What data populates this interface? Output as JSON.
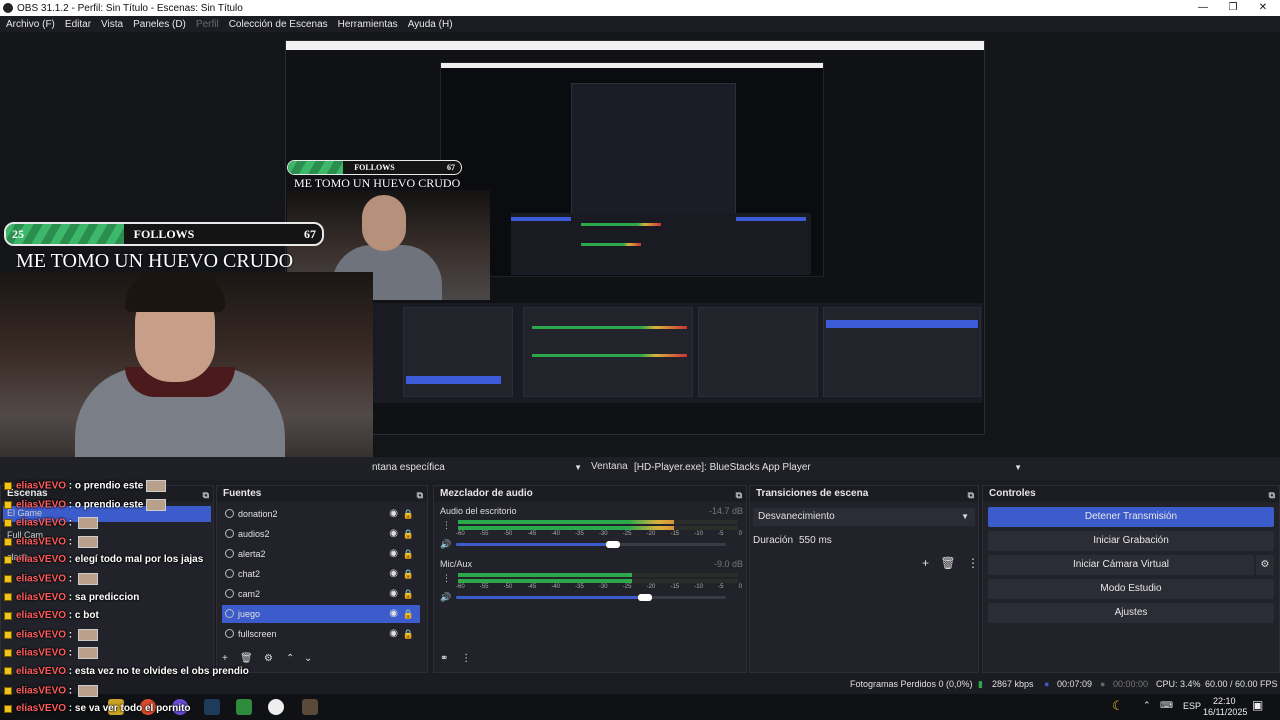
{
  "window": {
    "title": "OBS 31.1.2 - Perfil: Sin Título - Escenas: Sin Título",
    "minimize": "—",
    "maximize": "❐",
    "close": "✕"
  },
  "menu": [
    {
      "label": "Archivo (F)",
      "disabled": false
    },
    {
      "label": "Editar",
      "disabled": false
    },
    {
      "label": "Vista",
      "disabled": false
    },
    {
      "label": "Paneles (D)",
      "disabled": false
    },
    {
      "label": "Perfil",
      "disabled": true
    },
    {
      "label": "Colección de Escenas",
      "disabled": false
    },
    {
      "label": "Herramientas",
      "disabled": false
    },
    {
      "label": "Ayuda (H)",
      "disabled": false
    }
  ],
  "overlay": {
    "follow_left": "25",
    "follow_label": "FOLLOWS",
    "follow_right": "67",
    "headline": "ME TOMO UN HUEVO CRUDO"
  },
  "source_bar": {
    "method_value": "ntana específica",
    "window_label": "Ventana",
    "window_value": "[HD-Player.exe]: BlueStacks App Player"
  },
  "docks": {
    "scenes_title": "Escenas",
    "sources_title": "Fuentes",
    "mixer_title": "Mezclador de audio",
    "transitions_title": "Transiciones de escena",
    "controls_title": "Controles"
  },
  "scenes": [
    "El Game",
    "Full Cam",
    "clash"
  ],
  "sources": [
    {
      "name": "donation2",
      "selected": false
    },
    {
      "name": "audios2",
      "selected": false
    },
    {
      "name": "alerta2",
      "selected": false
    },
    {
      "name": "chat2",
      "selected": false
    },
    {
      "name": "cam2",
      "selected": false
    },
    {
      "name": "juego",
      "selected": true
    },
    {
      "name": "fullscreen",
      "selected": false
    }
  ],
  "mixer": [
    {
      "name": "Audio del escritorio",
      "db": "-14.7 dB",
      "level": 0.77,
      "volume": 0.58
    },
    {
      "name": "Mic/Aux",
      "db": "-9.0 dB",
      "level": 0.62,
      "volume": 0.7
    }
  ],
  "meter_ticks": [
    "-60",
    "-55",
    "-50",
    "-45",
    "-40",
    "-35",
    "-30",
    "-25",
    "-20",
    "-15",
    "-10",
    "-5",
    "0"
  ],
  "transitions": {
    "selected": "Desvanecimiento",
    "duration_label": "Duración",
    "duration_value": "550 ms"
  },
  "controls": {
    "stream": "Detener Transmisión",
    "record": "Iniciar Grabación",
    "virtual_cam": "Iniciar Cámara Virtual",
    "studio": "Modo Estudio",
    "settings": "Ajustes"
  },
  "chat": [
    {
      "user": "eliasVEVO",
      "msg": "o prendio este",
      "emote": true
    },
    {
      "user": "eliasVEVO",
      "msg": "o prendio este",
      "emote": true
    },
    {
      "user": "eliasVEVO",
      "msg": "",
      "emote": true
    },
    {
      "user": "eliasVEVO",
      "msg": "",
      "emote": true
    },
    {
      "user": "eliasVEVO",
      "msg": "elegí todo mal por los jajas",
      "emote": false
    },
    {
      "user": "eliasVEVO",
      "msg": "",
      "emote": true
    },
    {
      "user": "eliasVEVO",
      "msg": "sa prediccion",
      "emote": false
    },
    {
      "user": "eliasVEVO",
      "msg": "c bot",
      "emote": false
    },
    {
      "user": "eliasVEVO",
      "msg": "",
      "emote": true
    },
    {
      "user": "eliasVEVO",
      "msg": "",
      "emote": true
    },
    {
      "user": "eliasVEVO",
      "msg": "esta vez no te olvides el obs prendio",
      "emote": false
    },
    {
      "user": "eliasVEVO",
      "msg": "",
      "emote": true
    },
    {
      "user": "eliasVEVO",
      "msg": "se va ver todo el pornito",
      "emote": false
    }
  ],
  "status": {
    "dropped": "Fotogramas Perdidos 0 (0,0%)",
    "bitrate": "2867 kbps",
    "stream_time": "00:07:09",
    "rec_time": "00:00:00",
    "cpu": "CPU: 3.4%",
    "fps": "60.00 / 60.00 FPS"
  },
  "tray": {
    "lang": "ESP",
    "time": "22:10",
    "date": "16/11/2025"
  },
  "colors": {
    "accent": "#3c5ccc",
    "chat_user": "#ff5b5b",
    "meter_green": "#2aa84a",
    "meter_yellow": "#d9b13c",
    "meter_red": "#cc3333"
  }
}
